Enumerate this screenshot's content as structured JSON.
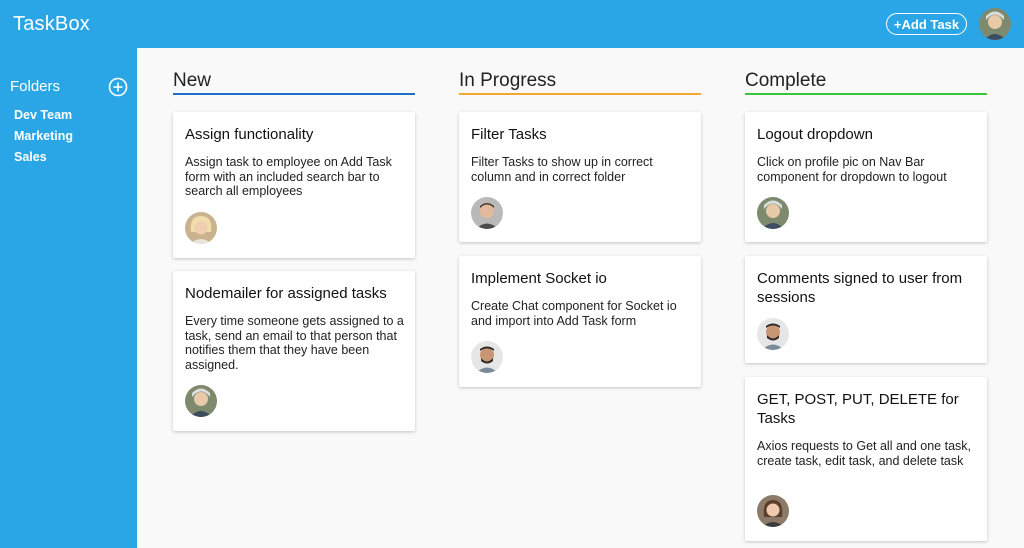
{
  "app": {
    "title": "TaskBox"
  },
  "header": {
    "add_task_label": "+Add Task"
  },
  "sidebar": {
    "folders_title": "Folders",
    "items": [
      {
        "label": "Dev Team"
      },
      {
        "label": "Marketing"
      },
      {
        "label": "Sales"
      }
    ]
  },
  "columns": [
    {
      "title": "New",
      "accent": "#1f6fc6",
      "cards": [
        {
          "title": "Assign functionality",
          "description": "Assign task to employee on Add Task form with an included search bar to search all employees"
        },
        {
          "title": "Nodemailer for assigned tasks",
          "description": "Every time someone gets assigned to a task, send an email to that person that notifies them that they have been assigned."
        }
      ]
    },
    {
      "title": "In Progress",
      "accent": "#f0a830",
      "cards": [
        {
          "title": "Filter Tasks",
          "description": "Filter Tasks to show up in correct column and in correct folder"
        },
        {
          "title": "Implement Socket io",
          "description": "Create Chat component for Socket io and import into Add Task form"
        }
      ]
    },
    {
      "title": "Complete",
      "accent": "#3cc33c",
      "cards": [
        {
          "title": "Logout dropdown",
          "description": "Click on profile pic on Nav Bar component for dropdown to logout"
        },
        {
          "title": "Comments signed to user from sessions",
          "description": ""
        },
        {
          "title": "GET, POST, PUT, DELETE for Tasks",
          "description": "Axios requests to Get all and one task, create task, edit task, and delete task"
        }
      ]
    }
  ],
  "colors": {
    "primary": "#2aa6e6",
    "background": "#f9f9f9"
  }
}
